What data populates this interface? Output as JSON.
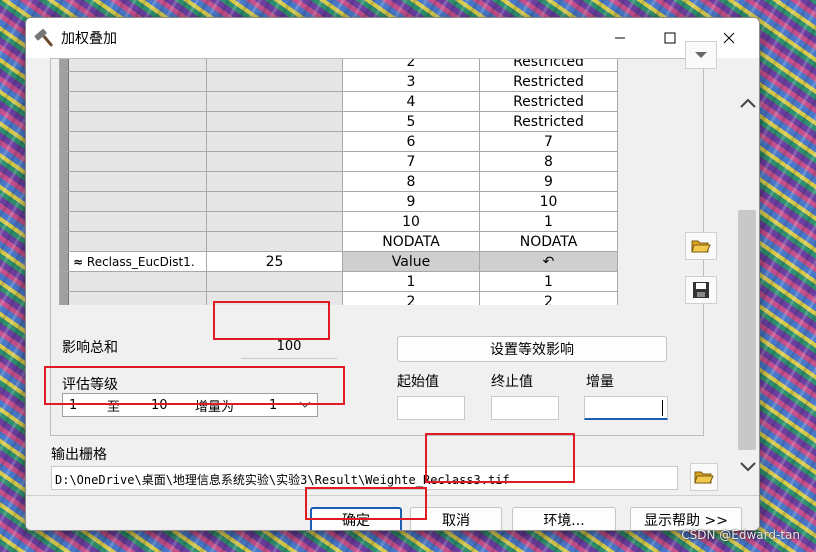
{
  "window": {
    "title": "加权叠加"
  },
  "table": {
    "top_rows": [
      {
        "from": "2",
        "to": "Restricted"
      },
      {
        "from": "3",
        "to": "Restricted"
      },
      {
        "from": "4",
        "to": "Restricted"
      },
      {
        "from": "5",
        "to": "Restricted"
      },
      {
        "from": "6",
        "to": "7"
      },
      {
        "from": "7",
        "to": "8"
      },
      {
        "from": "8",
        "to": "9"
      },
      {
        "from": "9",
        "to": "10"
      },
      {
        "from": "10",
        "to": "1"
      },
      {
        "from": "NODATA",
        "to": "NODATA"
      }
    ],
    "raster_row": {
      "name": "Reclass_EucDist1.",
      "influence": "25",
      "field": "Value",
      "scale_symbol": "↶"
    },
    "bottom_rows": [
      {
        "from": "1",
        "to": "1"
      },
      {
        "from": "2",
        "to": "2"
      }
    ]
  },
  "influence_sum": {
    "label": "影响总和",
    "value": "100"
  },
  "equal_influence_button": "设置等效影响",
  "eval_scale": {
    "label": "评估等级",
    "from": "1",
    "to_word": "至",
    "to": "10",
    "increment_word": "增量为",
    "increment": "1"
  },
  "range_fields": {
    "start_label": "起始值",
    "end_label": "终止值",
    "step_label": "增量"
  },
  "output": {
    "label": "输出栅格",
    "path": "D:\\OneDrive\\桌面\\地理信息系统实验\\实验3\\Result\\Weighte_Reclass3.tif"
  },
  "buttons": {
    "ok": "确定",
    "cancel": "取消",
    "env": "环境...",
    "help": "显示帮助 >>"
  },
  "watermark": "CSDN @Edward-tan",
  "colors": {
    "highlight": "#e01b24",
    "focus_underline": "#1a5fb4"
  }
}
